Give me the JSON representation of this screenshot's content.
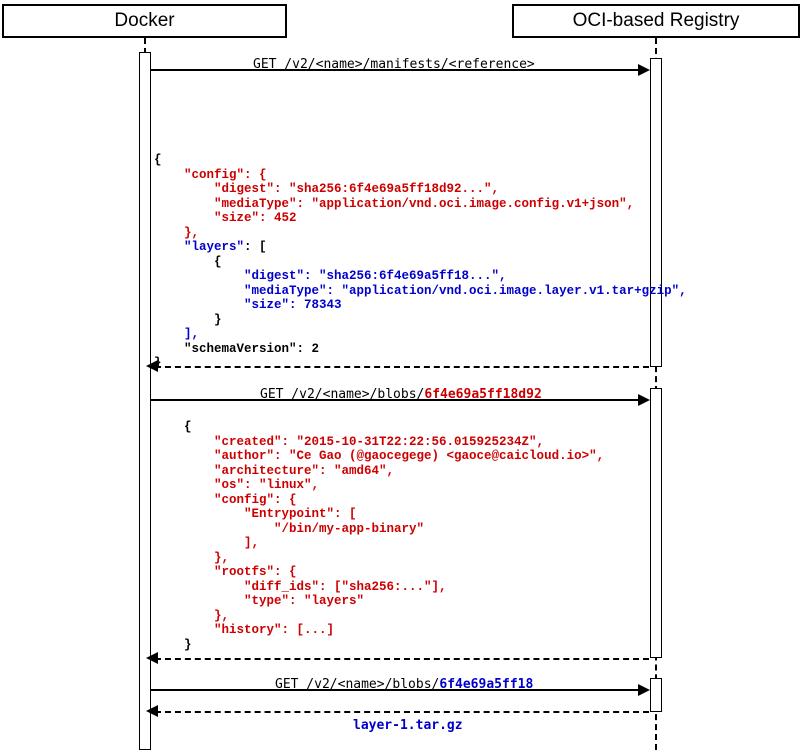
{
  "participants": {
    "left": "Docker",
    "right": "OCI-based Registry"
  },
  "messages": {
    "m1": "GET /v2/<name>/manifests/<reference>",
    "m2_prefix": "GET /v2/<name>/blobs/",
    "m2_hash": "6f4e69a5ff18d92",
    "m3_prefix": "GET /v2/<name>/blobs/",
    "m3_hash": "6f4e69a5ff18",
    "m4": "layer-1.tar.gz"
  },
  "json1": {
    "l1": "{",
    "l2": "    \"config\": {",
    "l3": "        \"digest\": \"sha256:6f4e69a5ff18d92...\",",
    "l4": "        \"mediaType\": \"application/vnd.oci.image.config.v1+json\",",
    "l5": "        \"size\": 452",
    "l6": "    },",
    "l7a": "    \"layers\"",
    "l7b": ": [",
    "l8": "        {",
    "l9": "            \"digest\": \"sha256:6f4e69a5ff18...\",",
    "l10": "            \"mediaType\": \"application/vnd.oci.image.layer.v1.tar+gzip\",",
    "l11": "            \"size\": 78343",
    "l12": "        }",
    "l13": "    ],",
    "l14a": "    \"schemaVersion\"",
    "l14b": ": 2",
    "l15": "}"
  },
  "json2": {
    "l1": "    {",
    "l2": "        \"created\": \"2015-10-31T22:22:56.015925234Z\",",
    "l3": "        \"author\": \"Ce Gao (@gaocegege) <gaoce@caicloud.io>\",",
    "l4": "        \"architecture\": \"amd64\",",
    "l5": "        \"os\": \"linux\",",
    "l6": "        \"config\": {",
    "l7": "            \"Entrypoint\": [",
    "l8": "                \"/bin/my-app-binary\"",
    "l9": "            ],",
    "l10": "        },",
    "l11": "        \"rootfs\": {",
    "l12": "            \"diff_ids\": [\"sha256:...\"],",
    "l13": "            \"type\": \"layers\"",
    "l14": "        },",
    "l15": "        \"history\": [...]",
    "l16": "    }"
  },
  "chart_data": {
    "type": "sequence_diagram",
    "participants": [
      "Docker",
      "OCI-based Registry"
    ],
    "interactions": [
      {
        "from": "Docker",
        "to": "OCI-based Registry",
        "label": "GET /v2/<name>/manifests/<reference>",
        "response_payload": "manifest JSON (config, layers, schemaVersion)"
      },
      {
        "from": "Docker",
        "to": "OCI-based Registry",
        "label": "GET /v2/<name>/blobs/6f4e69a5ff18d92",
        "response_payload": "image config JSON"
      },
      {
        "from": "Docker",
        "to": "OCI-based Registry",
        "label": "GET /v2/<name>/blobs/6f4e69a5ff18",
        "response_payload": "layer-1.tar.gz"
      }
    ]
  }
}
